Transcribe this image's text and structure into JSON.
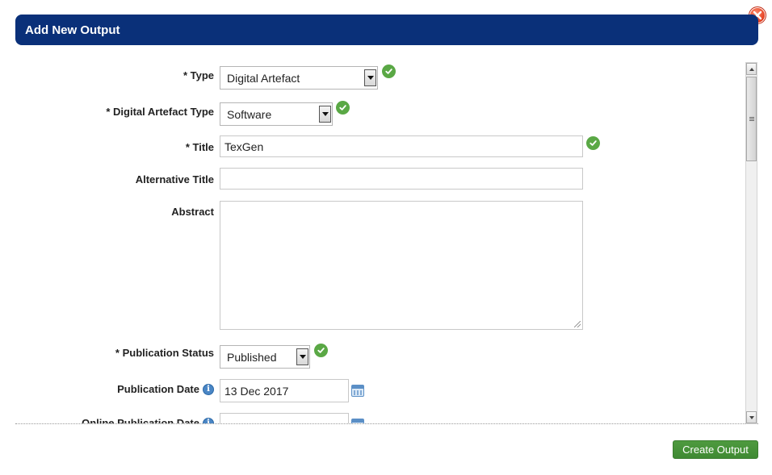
{
  "dialog": {
    "title": "Add New Output",
    "close_icon": "close-icon"
  },
  "form": {
    "type": {
      "label": "* Type",
      "value": "Digital Artefact"
    },
    "digital_artefact_type": {
      "label": "* Digital Artefact Type",
      "value": "Software"
    },
    "title": {
      "label": "* Title",
      "value": "TexGen"
    },
    "alternative_title": {
      "label": "Alternative Title",
      "value": ""
    },
    "abstract": {
      "label": "Abstract",
      "value": ""
    },
    "publication_status": {
      "label": "* Publication Status",
      "value": "Published"
    },
    "publication_date": {
      "label": "Publication Date",
      "value": "13 Dec 2017",
      "info": "i"
    },
    "online_publication_date": {
      "label": "Online Publication Date",
      "value": "",
      "info": "i"
    }
  },
  "footer": {
    "create_label": "Create Output"
  },
  "colors": {
    "header_bg": "#0a3079",
    "button_bg": "#3f8a33",
    "check_green": "#5aa845",
    "close_red": "#e23a1c"
  }
}
